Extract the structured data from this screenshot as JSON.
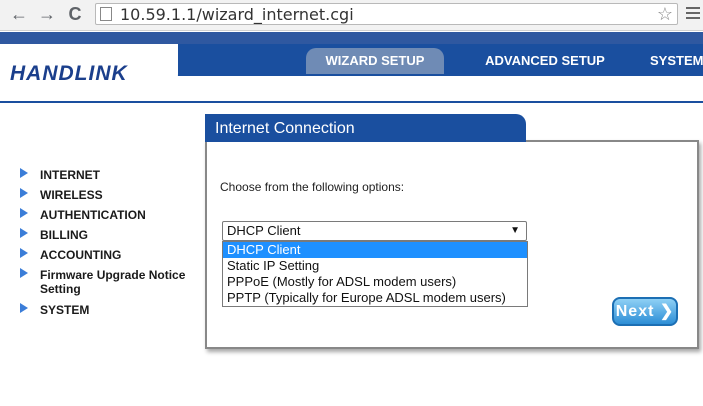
{
  "browser": {
    "url": "10.59.1.1/wizard_internet.cgi",
    "back_icon": "←",
    "forward_icon": "→",
    "reload_icon": "C",
    "star_icon": "☆"
  },
  "header": {
    "logo": "HANDLINK",
    "tabs": [
      {
        "label": "WIZARD SETUP",
        "active": true
      },
      {
        "label": "ADVANCED SETUP",
        "active": false
      },
      {
        "label": "SYSTEM",
        "active": false
      }
    ]
  },
  "sidebar": {
    "items": [
      {
        "label": "INTERNET"
      },
      {
        "label": "WIRELESS"
      },
      {
        "label": "AUTHENTICATION"
      },
      {
        "label": "BILLING"
      },
      {
        "label": "ACCOUNTING"
      },
      {
        "label": "Firmware Upgrade Notice Setting"
      },
      {
        "label": "SYSTEM"
      }
    ]
  },
  "panel": {
    "title": "Internet Connection",
    "prompt": "Choose from the following options:",
    "select": {
      "value": "DHCP Client",
      "arrow": "▼",
      "options": [
        "DHCP Client",
        "Static IP Setting",
        "PPPoE (Mostly for ADSL modem users)",
        "PPTP (Typically for Europe ADSL modem users)"
      ],
      "highlighted_index": 0
    },
    "next_label": "Next ❯"
  },
  "colors": {
    "brand_blue": "#1a4f9f",
    "active_tab": "#6f8bb5",
    "highlight": "#1e90ff"
  }
}
